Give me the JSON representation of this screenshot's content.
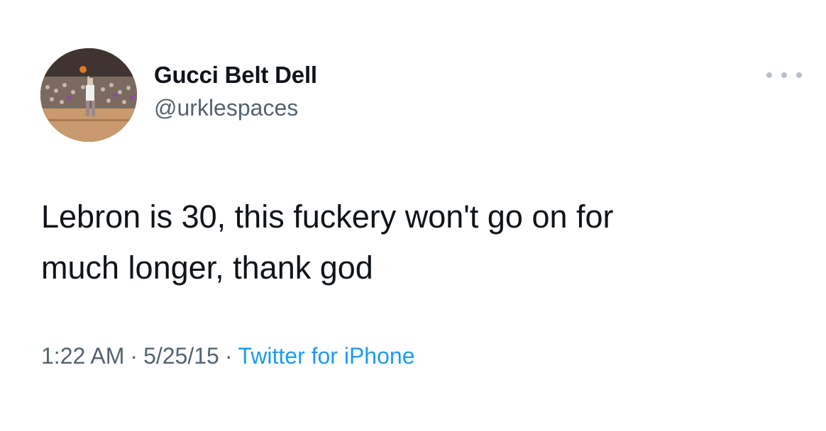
{
  "author": {
    "display_name": "Gucci Belt Dell",
    "handle": "@urklespaces",
    "avatar_icon": "basketball-player-photo"
  },
  "tweet": {
    "text": "Lebron is 30, this fuckery won't go on for\nmuch longer, thank god",
    "time": "1:22 AM",
    "date": "5/25/15",
    "separator": "·",
    "source": "Twitter for iPhone"
  },
  "colors": {
    "text": "#0f1419",
    "secondary": "#536471",
    "link": "#1d9bf0",
    "background": "#ffffff"
  },
  "icons": {
    "more": "more-options-icon"
  }
}
